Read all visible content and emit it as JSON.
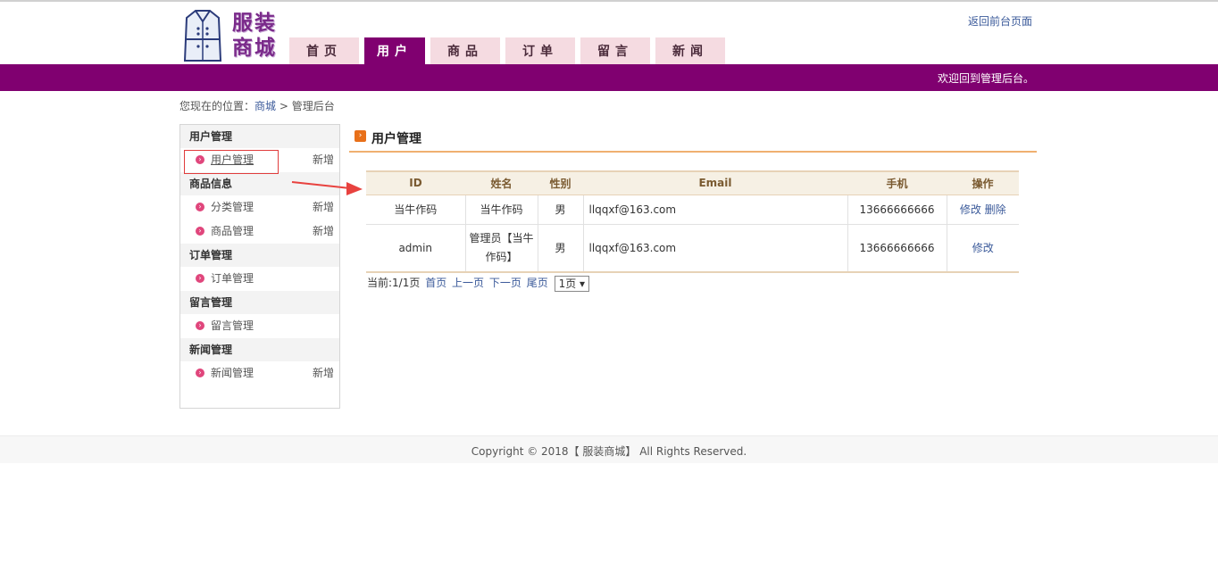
{
  "header": {
    "logo_text": "服装商城",
    "back_link": "返回前台页面",
    "nav": [
      {
        "label": "首页",
        "active": false
      },
      {
        "label": "用户",
        "active": true
      },
      {
        "label": "商品",
        "active": false
      },
      {
        "label": "订单",
        "active": false
      },
      {
        "label": "留言",
        "active": false
      },
      {
        "label": "新闻",
        "active": false
      }
    ],
    "welcome": "欢迎回到管理后台。"
  },
  "breadcrumb": {
    "prefix": "您现在的位置：",
    "home": "商城",
    "sep": ">",
    "current": "管理后台"
  },
  "sidebar": {
    "groups": [
      {
        "title": "用户管理",
        "items": [
          {
            "label": "用户管理",
            "add": "新增"
          }
        ]
      },
      {
        "title": "商品信息",
        "items": [
          {
            "label": "分类管理",
            "add": "新增"
          },
          {
            "label": "商品管理",
            "add": "新增"
          }
        ]
      },
      {
        "title": "订单管理",
        "items": [
          {
            "label": "订单管理"
          }
        ]
      },
      {
        "title": "留言管理",
        "items": [
          {
            "label": "留言管理"
          }
        ]
      },
      {
        "title": "新闻管理",
        "items": [
          {
            "label": "新闻管理",
            "add": "新增"
          }
        ]
      }
    ]
  },
  "main": {
    "title": "用户管理",
    "table": {
      "headers": [
        "ID",
        "姓名",
        "性别",
        "Email",
        "手机",
        "操作"
      ],
      "rows": [
        {
          "id": "当牛作码",
          "name": "当牛作码",
          "gender": "男",
          "email": "llqqxf@163.com",
          "phone": "13666666666",
          "edit": "修改",
          "delete": "删除"
        },
        {
          "id": "admin",
          "name": "管理员【当牛作码】",
          "gender": "男",
          "email": "llqqxf@163.com",
          "phone": "13666666666",
          "edit": "修改"
        }
      ]
    },
    "pager": {
      "current": "当前:1/1页",
      "first": "首页",
      "prev": "上一页",
      "next": "下一页",
      "last": "尾页",
      "select_value": "1页"
    }
  },
  "footer": {
    "copyright": "Copyright © 2018【 服装商城】 All Rights Reserved."
  },
  "colors": {
    "brand_purple": "#800070",
    "tab_inactive": "#f5dbe1",
    "accent_orange": "#f0b070",
    "link_blue": "#3b5a9a",
    "highlight_red": "#e03c3c"
  }
}
